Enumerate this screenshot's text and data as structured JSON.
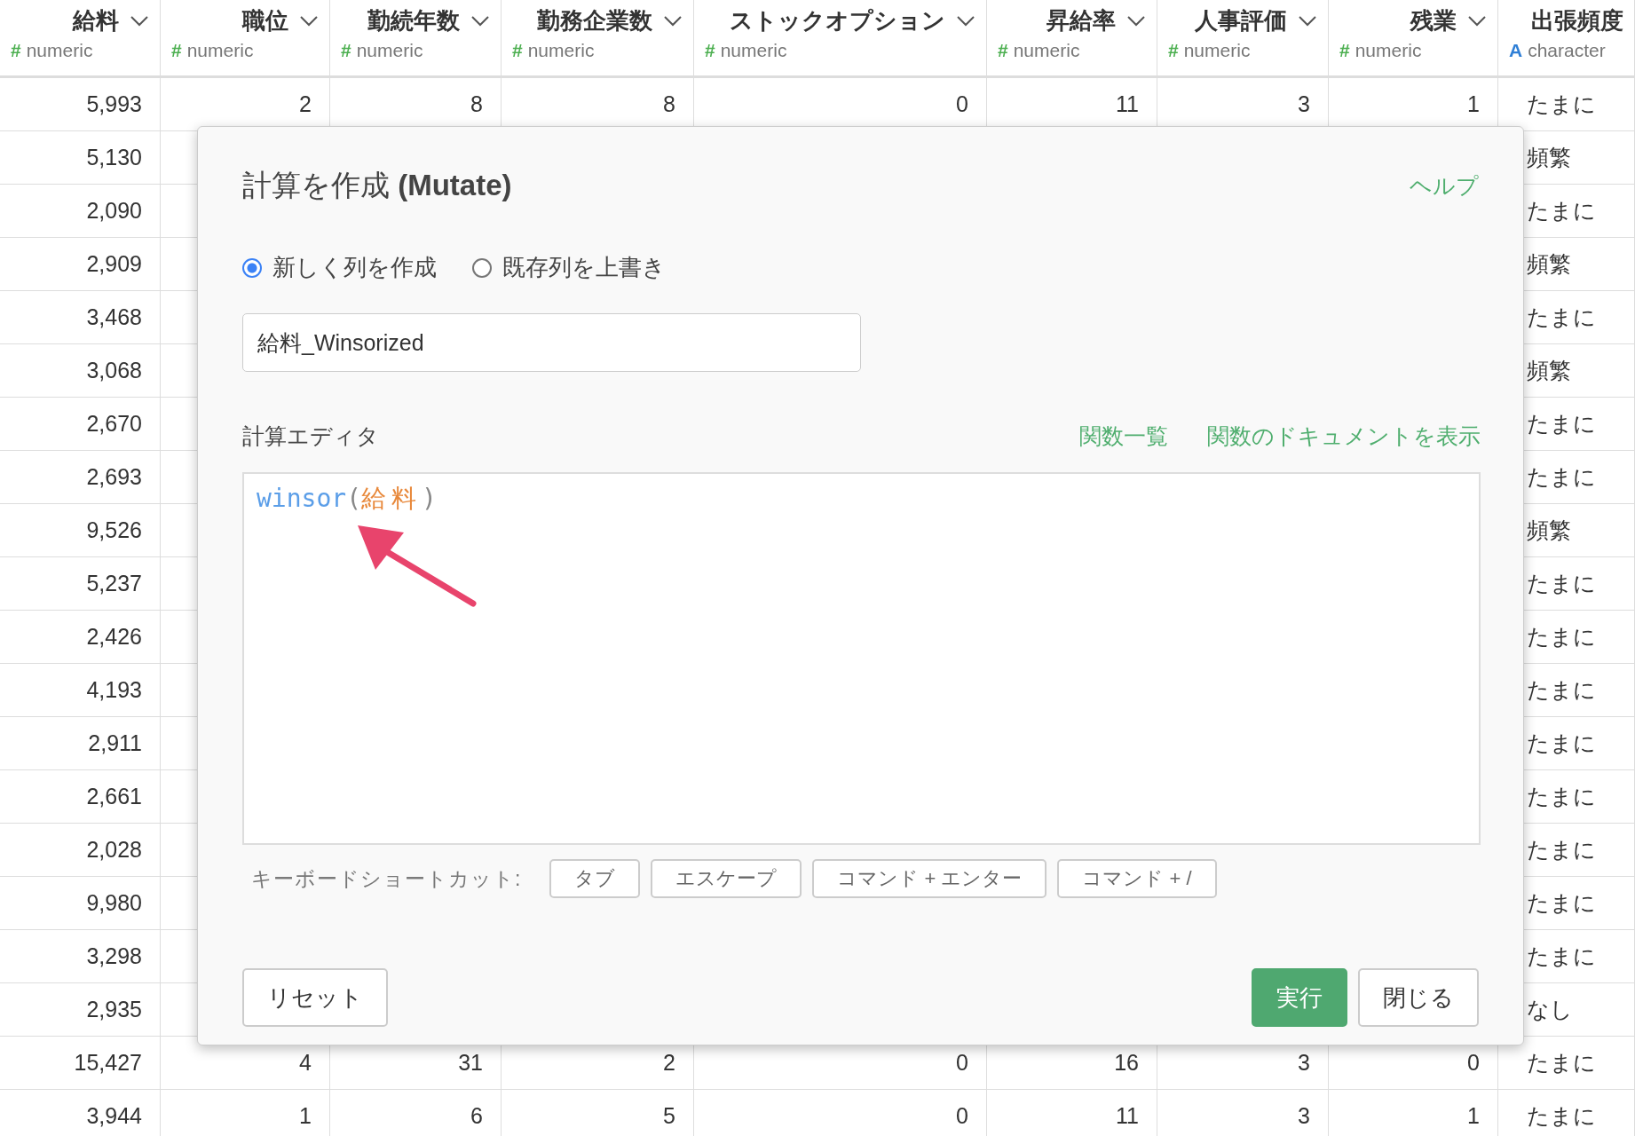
{
  "table": {
    "columns": [
      {
        "name": "給料",
        "type_icon": "#",
        "type": "numeric",
        "kind": "number"
      },
      {
        "name": "職位",
        "type_icon": "#",
        "type": "numeric",
        "kind": "number"
      },
      {
        "name": "勤続年数",
        "type_icon": "#",
        "type": "numeric",
        "kind": "number"
      },
      {
        "name": "勤務企業数",
        "type_icon": "#",
        "type": "numeric",
        "kind": "number"
      },
      {
        "name": "ストックオプション",
        "type_icon": "#",
        "type": "numeric",
        "kind": "number"
      },
      {
        "name": "昇給率",
        "type_icon": "#",
        "type": "numeric",
        "kind": "number"
      },
      {
        "name": "人事評価",
        "type_icon": "#",
        "type": "numeric",
        "kind": "number"
      },
      {
        "name": "残業",
        "type_icon": "#",
        "type": "numeric",
        "kind": "number"
      },
      {
        "name": "出張頻度",
        "type_icon": "A",
        "type": "character",
        "kind": "text"
      }
    ],
    "rows": [
      {
        "cells": [
          "5,993",
          "2",
          "8",
          "8",
          "0",
          "11",
          "3",
          "1",
          "たまに"
        ]
      },
      {
        "cells": [
          "5,130"
        ],
        "end_cell": "頻繁"
      },
      {
        "cells": [
          "2,090"
        ],
        "end_cell": "たまに"
      },
      {
        "cells": [
          "2,909"
        ],
        "end_cell": "頻繁"
      },
      {
        "cells": [
          "3,468"
        ],
        "end_cell": "たまに"
      },
      {
        "cells": [
          "3,068"
        ],
        "end_cell": "頻繁"
      },
      {
        "cells": [
          "2,670"
        ],
        "end_cell": "たまに"
      },
      {
        "cells": [
          "2,693"
        ],
        "end_cell": "たまに"
      },
      {
        "cells": [
          "9,526"
        ],
        "end_cell": "頻繁"
      },
      {
        "cells": [
          "5,237"
        ],
        "end_cell": "たまに"
      },
      {
        "cells": [
          "2,426"
        ],
        "end_cell": "たまに"
      },
      {
        "cells": [
          "4,193"
        ],
        "end_cell": "たまに"
      },
      {
        "cells": [
          "2,911"
        ],
        "end_cell": "たまに"
      },
      {
        "cells": [
          "2,661"
        ],
        "end_cell": "たまに"
      },
      {
        "cells": [
          "2,028"
        ],
        "end_cell": "たまに"
      },
      {
        "cells": [
          "9,980"
        ],
        "end_cell": "たまに"
      },
      {
        "cells": [
          "3,298"
        ],
        "end_cell": "たまに"
      },
      {
        "cells": [
          "2,935"
        ],
        "end_cell": "なし"
      },
      {
        "cells": [
          "15,427",
          "4",
          "31",
          "2",
          "0",
          "16",
          "3",
          "0",
          "たまに"
        ]
      },
      {
        "cells": [
          "3,944",
          "1",
          "6",
          "5",
          "0",
          "11",
          "3",
          "1",
          "たまに"
        ]
      }
    ]
  },
  "dialog": {
    "title": "計算を作成 **(Mutate)**",
    "help": "ヘルプ",
    "modes": [
      {
        "label": "新しく列を作成",
        "selected": true
      },
      {
        "label": "既存列を上書き",
        "selected": false
      }
    ],
    "column_name": "給料_Winsorized",
    "editor_label": "計算エディタ",
    "links": [
      "関数一覧",
      "関数のドキュメントを表示"
    ],
    "code": [
      {
        "text": "winsor",
        "kind": "function"
      },
      {
        "text": "(",
        "kind": "paren"
      },
      {
        "text": "給料",
        "kind": "column"
      },
      {
        "text": ")",
        "kind": "paren"
      }
    ],
    "shortcuts_label": "キーボードショートカット:",
    "shortcuts": [
      "タブ",
      "エスケープ",
      "コマンド + エンター",
      "コマンド + /"
    ],
    "reset": "リセット",
    "run": "実行",
    "close": "閉じる"
  }
}
